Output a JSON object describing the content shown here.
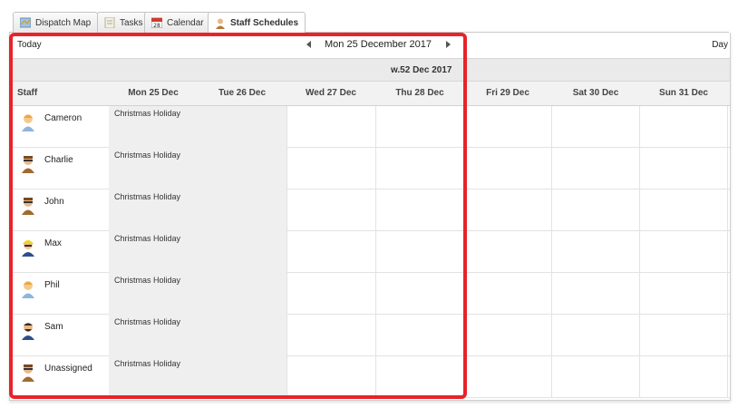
{
  "tabs": [
    {
      "label": "Dispatch Map",
      "icon": "map-icon"
    },
    {
      "label": "Tasks",
      "icon": "tasks-icon"
    },
    {
      "label": "Calendar",
      "icon": "calendar-icon"
    },
    {
      "label": "Staff Schedules",
      "icon": "person-icon",
      "active": true
    }
  ],
  "nav": {
    "today_label": "Today",
    "current_date": "Mon 25 December 2017",
    "view_label": "Day"
  },
  "week_label": "w.52 Dec 2017",
  "columns": {
    "staff": "Staff",
    "days": [
      "Mon 25 Dec",
      "Tue 26 Dec",
      "Wed 27 Dec",
      "Thu 28 Dec",
      "Fri 29 Dec",
      "Sat 30 Dec",
      "Sun 31 Dec"
    ]
  },
  "staff": [
    {
      "name": "Cameron",
      "event": "Christmas Holiday",
      "avatar": "blonde-person-icon"
    },
    {
      "name": "Charlie",
      "event": "Christmas Holiday",
      "avatar": "worker-person-icon"
    },
    {
      "name": "John",
      "event": "Christmas Holiday",
      "avatar": "worker-person-icon"
    },
    {
      "name": "Max",
      "event": "Christmas Holiday",
      "avatar": "hardhat-person-icon"
    },
    {
      "name": "Phil",
      "event": "Christmas Holiday",
      "avatar": "blonde-person-icon"
    },
    {
      "name": "Sam",
      "event": "Christmas Holiday",
      "avatar": "bearded-person-icon"
    },
    {
      "name": "Unassigned",
      "event": "Christmas Holiday",
      "avatar": "worker-person-icon"
    }
  ],
  "colors": {
    "highlight": "#e8232a",
    "holiday_bg": "#efefef"
  }
}
